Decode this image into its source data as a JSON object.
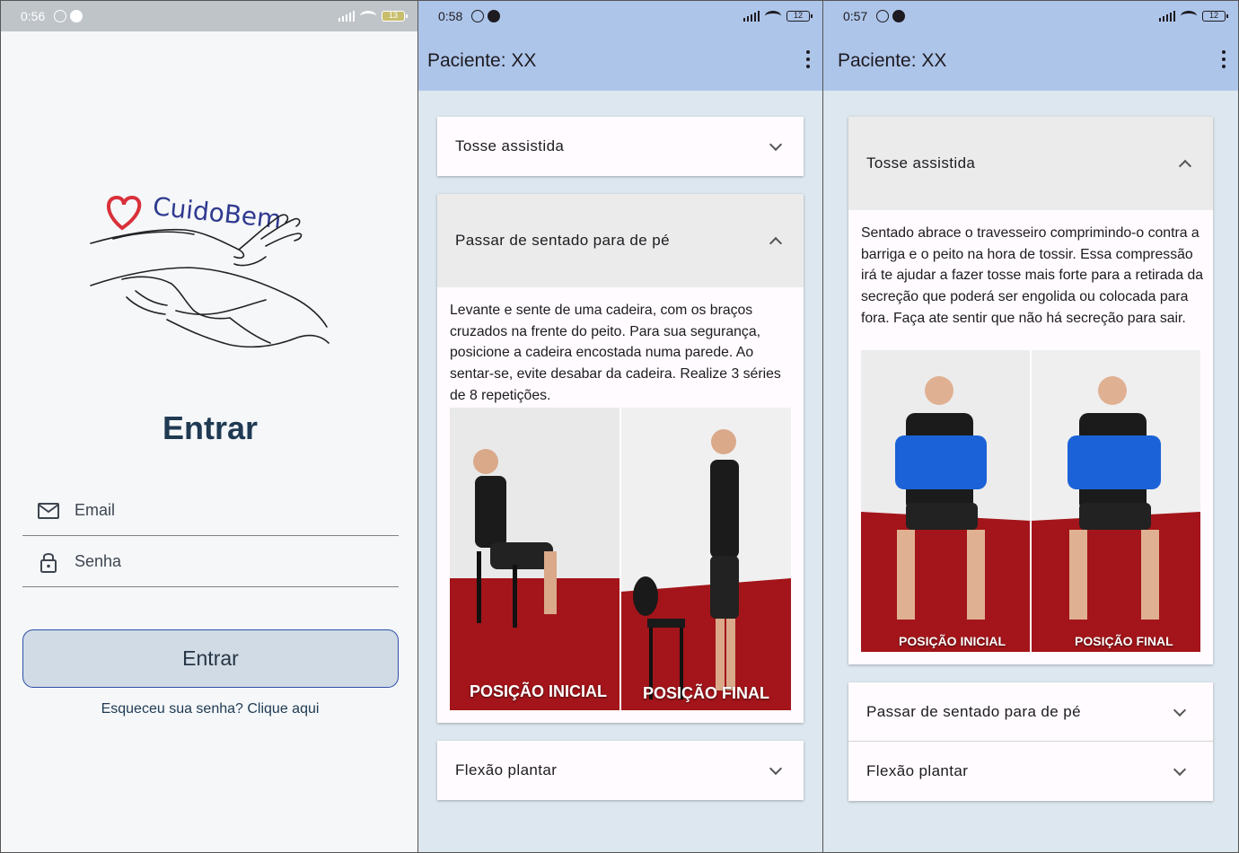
{
  "login": {
    "status": {
      "time": "0:56",
      "battery": "13"
    },
    "logo_text": "CuidoBem",
    "title": "Entrar",
    "email_label": "Email",
    "password_label": "Senha",
    "button_label": "Entrar",
    "forgot_link": "Esqueceu sua senha? Clique aqui"
  },
  "screen2": {
    "status": {
      "time": "0:58",
      "battery": "12"
    },
    "appbar_title": "Paciente: XX",
    "panels": [
      {
        "title": "Tosse assistida",
        "expanded": false
      },
      {
        "title": "Passar de sentado para de pé",
        "expanded": true,
        "body": "Levante e sente de uma cadeira, com os braços cruzados na frente do peito. Para sua segurança, posicione a cadeira encostada numa parede. Ao sentar-se, evite desabar da cadeira. Realize 3 séries de 8 repetições.",
        "caption_left": "POSIÇÃO INICIAL",
        "caption_right": "POSIÇÃO FINAL"
      },
      {
        "title": "Flexão plantar",
        "expanded": false
      }
    ]
  },
  "screen3": {
    "status": {
      "time": "0:57",
      "battery": "12"
    },
    "appbar_title": "Paciente: XX",
    "panels": [
      {
        "title": "Tosse assistida",
        "expanded": true,
        "body": "Sentado abrace o travesseiro comprimindo-o contra a barriga e o peito na hora de tossir. Essa compressão irá te ajudar a fazer tosse mais forte para a retirada da secreção que poderá ser engolida ou colocada para fora. Faça ate sentir que não há secreção para sair.",
        "caption_left": "POSIÇÃO INICIAL",
        "caption_right": "POSIÇÃO FINAL"
      },
      {
        "title": "Passar de sentado para de pé",
        "expanded": false
      },
      {
        "title": "Flexão plantar",
        "expanded": false
      }
    ]
  },
  "colors": {
    "appbar": "#aec5ea",
    "background": "#dde7ef",
    "login_button": "#d0dbe5",
    "login_button_border": "#2f4fa8",
    "title_text": "#1f3a52",
    "heart": "#d9303a",
    "logo_text": "#2f3a8f",
    "floor_red": "#a3151a"
  },
  "icons": [
    "alarm-icon",
    "signal-icon",
    "wifi-icon",
    "battery-icon",
    "mail-icon",
    "lock-icon",
    "more-vert-icon",
    "chevron-down-icon",
    "chevron-up-icon"
  ]
}
